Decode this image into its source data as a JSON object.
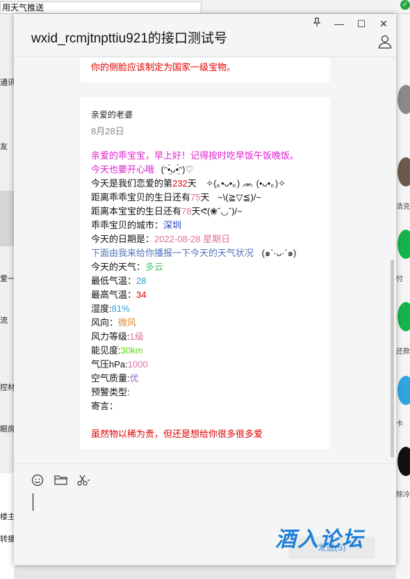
{
  "background": {
    "title": "用天气推送",
    "left_items": [
      "通讯",
      "友",
      "爱一",
      "流",
      "控材",
      "眼房",
      "楼主",
      "转播"
    ],
    "right_items": [
      "浩克",
      "付",
      "还款",
      "卡",
      "除冷"
    ]
  },
  "window": {
    "title": "wxid_rcmjtnpttiu921的接口测试号",
    "pin_icon": "pin-icon",
    "minimize": "—",
    "maximize": "☐",
    "close": "✕"
  },
  "messages": {
    "prev_line": "你的侧脸应该制定为国家一级宝物。",
    "sender": "亲爱的老婆",
    "date": "8月28日",
    "greeting1": "亲爱的乖宝宝，早上好！记得按时吃早饭午饭晚饭。",
    "greeting2": "今天也要开心哦",
    "greeting2_emoji": "(ᵔ•̤̀ᴗ•̤́ᵔ)♡",
    "love_prefix": "今天是我们恋爱的第",
    "love_days": "232",
    "love_suffix": "天",
    "love_emoji": "✧(｡•ᴗ•｡) ᨏ (•ᴗ•｡)✧",
    "bd1_prefix": "距离乖乖宝贝的生日还有",
    "bd1_days": "75",
    "bd1_suffix": "天",
    "bd1_emoji": "~\\(≧▽≦)/~",
    "bd2_prefix": "距离本宝宝的生日还有",
    "bd2_days": "78",
    "bd2_suffix": "天",
    "bd2_emoji": "ᕙ(❀ˆ◡ˆ)/~",
    "city_label": "乖乖宝贝的城市：",
    "city": "深圳",
    "date_label": "今天的日期是：",
    "today": "2022-08-28  星期日",
    "broadcast": "下面由我来给你播报一下今天的天气状况",
    "broadcast_emoji": "(๑`·ᴗ·´๑)",
    "weather_label": "今天的天气：",
    "weather": "多云",
    "min_label": "最低气温：",
    "min_temp": "28",
    "max_label": "最高气温：",
    "max_temp": "34",
    "humidity_label": "湿度:",
    "humidity": "81%",
    "wind_label": "风向：",
    "wind": "微风",
    "wind_level_label": "风力等级:",
    "wind_level": "1级",
    "visibility_label": "能见度:",
    "visibility": "30km",
    "pressure_label": "气压hPa:",
    "pressure": "1000",
    "air_label": "空气质量:",
    "air": "优",
    "alert_label": "预警类型:",
    "message_label": "寄言：",
    "closing": "虽然物以稀为贵，但还是想给你很多很多爱"
  },
  "input": {
    "send_label": "发送(S)"
  },
  "watermark": "酒入论坛",
  "colors": {
    "red": "#e00000",
    "magenta": "#e020d0",
    "pink": "#e070a0",
    "blue": "#3a7bd5",
    "navy": "#1f3fb5",
    "green": "#4cc26a",
    "lime": "#55dd00",
    "orange": "#e08a2a",
    "purple": "#9c6ad0",
    "steel": "#4f74b8"
  }
}
